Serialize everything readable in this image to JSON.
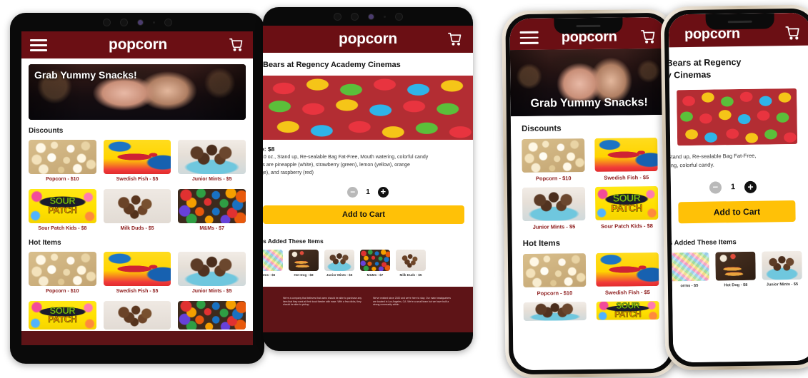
{
  "app": {
    "brand": "popcorn",
    "menu_icon": "hamburger-menu-icon",
    "cart_icon": "shopping-cart-icon"
  },
  "home": {
    "hero_title": "Grab Yummy Snacks!",
    "hero_image": "cinema-couple-with-popcorn-photo",
    "sections": [
      {
        "title": "Discounts",
        "items": [
          {
            "label": "Popcorn - $10",
            "image": "popcorn-photo"
          },
          {
            "label": "Swedish Fish - $5",
            "image": "swedish-fish-bag-photo"
          },
          {
            "label": "Junior Mints - $5",
            "image": "junior-mints-bowl-photo"
          },
          {
            "label": "Sour Patch Kids - $8",
            "image": "sour-patch-kids-bag-photo"
          },
          {
            "label": "Milk Duds - $5",
            "image": "milk-duds-photo"
          },
          {
            "label": "M&Ms - $7",
            "image": "mms-candy-photo"
          }
        ]
      },
      {
        "title": "Hot Items",
        "items": [
          {
            "label": "Popcorn - $10",
            "image": "popcorn-photo"
          },
          {
            "label": "Swedish Fish - $5",
            "image": "swedish-fish-bag-photo"
          },
          {
            "label": "Junior Mints - $5",
            "image": "junior-mints-bowl-photo"
          },
          {
            "label": "Sour Patch Kids - $8",
            "image": "sour-patch-kids-bag-photo"
          },
          {
            "label": "Milk Duds - $5",
            "image": "milk-duds-photo"
          },
          {
            "label": "M&Ms - $7",
            "image": "mms-candy-photo"
          }
        ]
      }
    ]
  },
  "detail": {
    "title": "Bears at Regency Academy Cinemas",
    "title_phone_line1": "Bears at Regency",
    "title_phone_line2": "y Cinemas",
    "hero_image": "gummy-bears-photo",
    "price_label": "e: $8",
    "description_lines": [
      "10 oz., Stand up, Re-sealable Bag Fat-Free, Mouth watering, colorful candy",
      "rs are pineapple (white), strawberry (green), lemon (yellow), orange",
      "ge), and raspberry (red)"
    ],
    "description_phone_lines": [
      "Stand up, Re-sealable Bag Fat-Free,",
      "ring, colorful candy."
    ],
    "quantity": "1",
    "minus_label": "−",
    "plus_label": "+",
    "add_to_cart_label": "Add to Cart",
    "related_title": "s Added These Items",
    "related_items": [
      {
        "label": "orms - $5",
        "image": "gummy-worms-photo"
      },
      {
        "label": "Hot Dog - $8",
        "image": "hot-dog-photo"
      },
      {
        "label": "Junior Mints - $5",
        "image": "junior-mints-bowl-photo"
      },
      {
        "label": "M&Ms - $7",
        "image": "mms-candy-photo"
      },
      {
        "label": "Milk Duds - $5",
        "image": "milk-duds-photo"
      }
    ],
    "footer": {
      "col1": "We're a company that believes that users should be able to purchase any item that they want at their local theater with ease. With a few clicks, they should be able to pickup",
      "col2": "We've existed since 2020 and we're here to stay. Our main headquarters are located in Los Angeles, CA. We're a small team but we have built a strong community within"
    }
  },
  "colors": {
    "brand_maroon": "#6b0f14",
    "footer_maroon": "#5e1417",
    "accent_amber": "#FFC107",
    "label_red": "#8c1a1a"
  }
}
